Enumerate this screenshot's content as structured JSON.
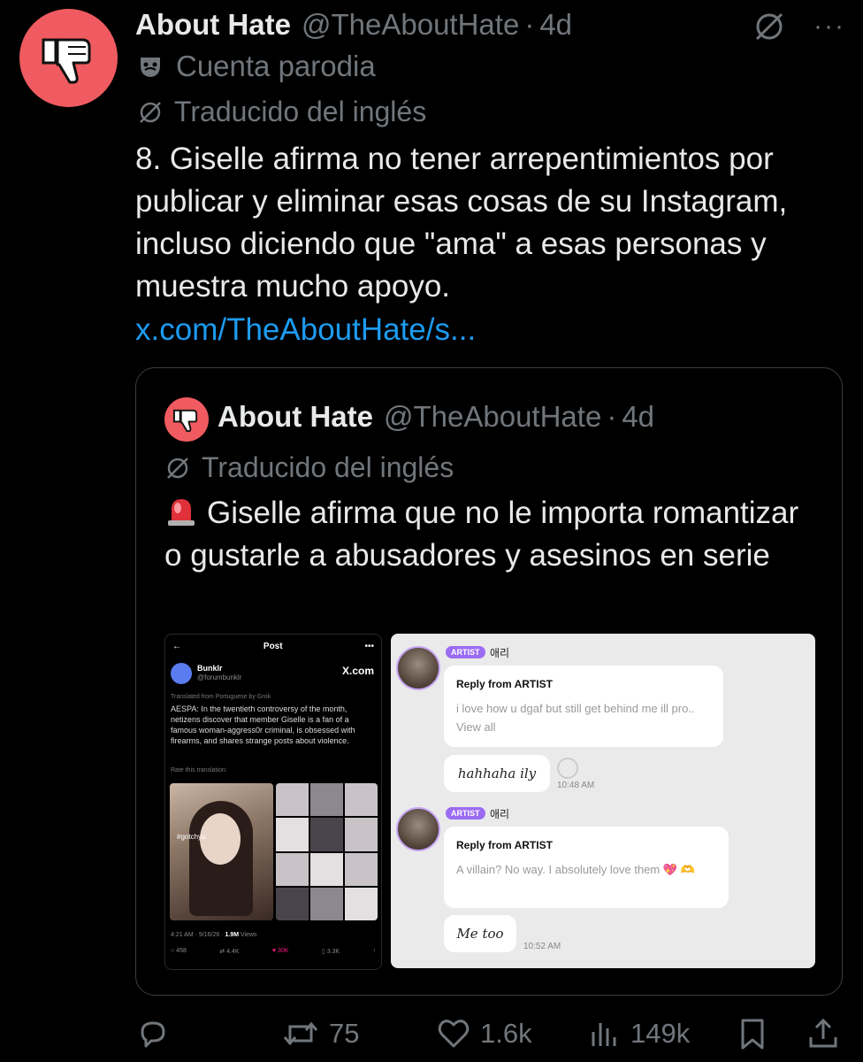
{
  "tweet": {
    "author_name": "About Hate",
    "author_handle": "@TheAboutHate",
    "separator": "·",
    "time": "4d",
    "more": "···",
    "parody_label": "Cuenta parodia",
    "translated_label": "Traducido del inglés",
    "text": "8. Giselle afirma no tener arrepentimientos por publicar y eliminar esas cosas de su Instagram, incluso diciendo que \"ama\" a esas personas y muestra mucho apoyo.",
    "link": "x.com/TheAboutHate/s..."
  },
  "quote": {
    "author_name": "About Hate",
    "author_handle": "@TheAboutHate",
    "separator": "·",
    "time": "4d",
    "translated_label": "Traducido del inglés",
    "text": "Giselle afirma que no le importa romantizar o gustarle a abusadores y asesinos en serie"
  },
  "embedded_post": {
    "back": "←",
    "title": "Post",
    "more": "•••",
    "name": "Bunklr",
    "handle": "@forumbunklr",
    "x_logo": "X.com",
    "translated": "Translated from Portuguese by Grok",
    "body": "AESPA: In the twentieth controversy of the month, netizens discover that member Giselle is a fan of a famous woman-aggress0r criminal, is obsessed with firearms, and shares strange posts about violence.",
    "rate": "Rate this translation:",
    "photo_tag": "#gotchyu",
    "meta_time": "4:21 AM · 9/16/26 · ",
    "meta_views_value": "1.9M",
    "meta_views_label": " Views",
    "stats": {
      "replies": "458",
      "reposts": "4.4K",
      "likes": "30K",
      "bookmarks": "3.3K"
    }
  },
  "embedded_chat": {
    "badge": "ARTIST",
    "artist_name": "애리",
    "messages": [
      {
        "title": "Reply from ARTIST",
        "body": "i love how u dgaf but still get behind me ill pro.. View all",
        "reply": "hahhaha ily",
        "time": "10:48 AM"
      },
      {
        "title": "Reply from ARTIST",
        "body": "A villain? No way. I absolutely love them 💖 🫶",
        "reply": "Me too",
        "time": "10:52 AM"
      }
    ]
  },
  "action_bar": {
    "reposts": "75",
    "likes": "1.6k",
    "views": "149k"
  },
  "colors": {
    "accent": "#1d9bf0",
    "muted": "#71767b",
    "avatar": "#ef5b60",
    "background": "#000000"
  }
}
